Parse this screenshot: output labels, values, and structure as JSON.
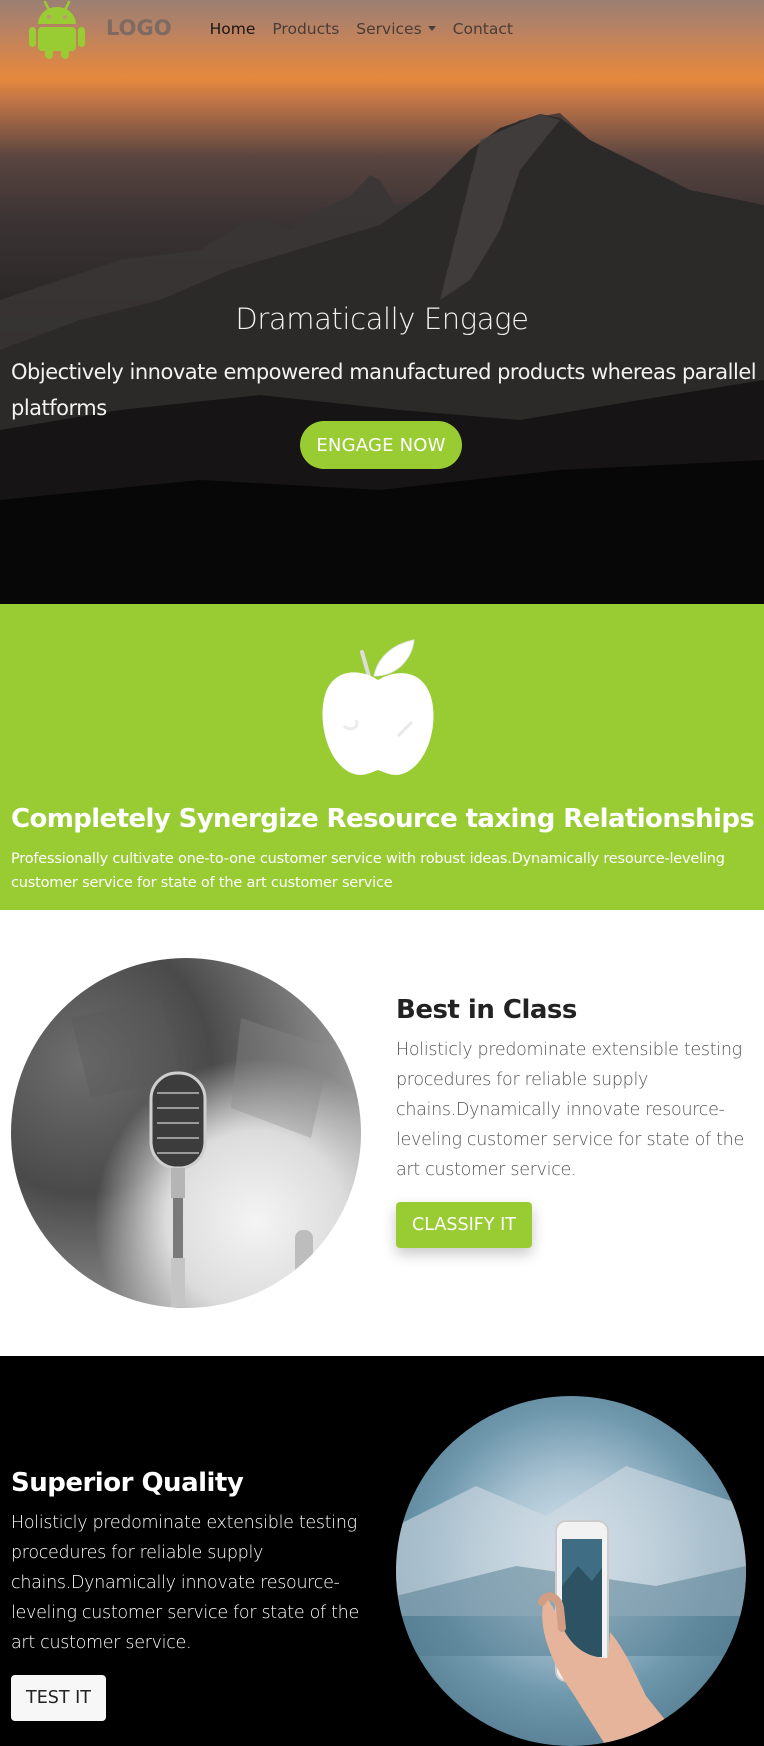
{
  "nav": {
    "logo_icon": "android-icon",
    "logo_text": "LOGO",
    "links": [
      "Home",
      "Products",
      "Services",
      "Contact"
    ],
    "active": "Home"
  },
  "hero": {
    "title": "Dramatically Engage",
    "subtitle": "Objectively innovate empowered manufactured products whereas parallel platforms",
    "cta_label": "ENGAGE NOW"
  },
  "feature": {
    "icon": "apple-icon",
    "title": "Completely Synergize Resource taxing Relationships",
    "text": "Professionally cultivate one-to-one customer service with robust ideas.Dynamically resource-leveling customer service for state of the art customer service"
  },
  "best": {
    "title": "Best in Class",
    "text": "Holisticly predominate extensible testing procedures for reliable supply chains.Dynamically innovate resource-leveling customer service for state of the art customer service.",
    "button_label": "CLASSIFY IT"
  },
  "superior": {
    "title": "Superior Quality",
    "text": "Holisticly predominate extensible testing procedures for reliable supply chains.Dynamically innovate resource-leveling customer service for state of the art customer service.",
    "button_label": "TEST IT"
  },
  "colors": {
    "accent": "#99cc33",
    "dark": "#000000",
    "light": "#ffffff"
  }
}
